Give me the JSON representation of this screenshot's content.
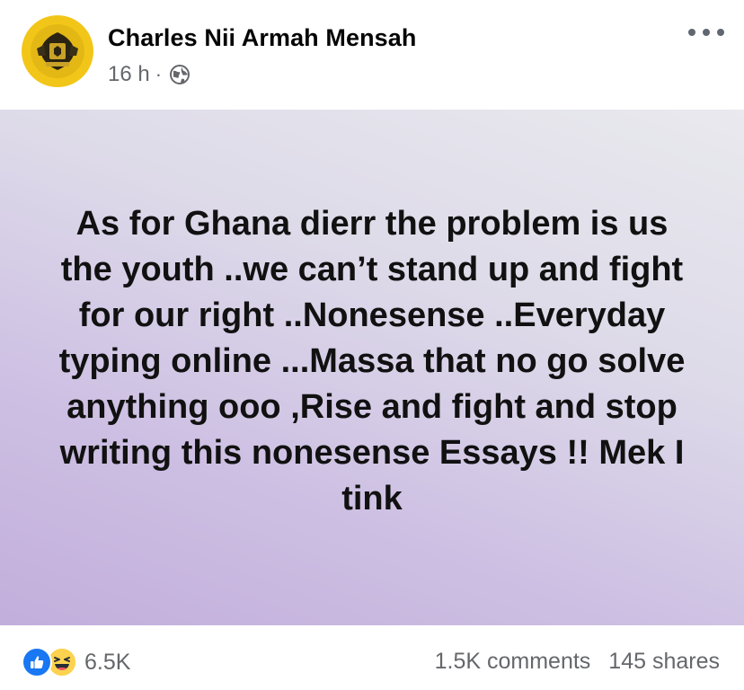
{
  "post": {
    "author": "Charles Nii Armah Mensah",
    "time": "16 h",
    "separator": "·",
    "privacy_icon": "globe-icon",
    "more_icon": "more-options-icon",
    "text": "As for Ghana dierr the problem is us the youth ..we can’t stand up and fight for our right ..Nonesense ..Everyday typing online ...Massa that no go solve anything ooo ,Rise and fight and stop writing this nonesense Essays !! Mek I tink",
    "background_colors": [
      "#e9e9ee",
      "#c2aedb"
    ]
  },
  "footer": {
    "reaction_icons": [
      "like-icon",
      "haha-icon"
    ],
    "reaction_count": "6.5K",
    "comments": "1.5K comments",
    "shares": "145 shares"
  },
  "colors": {
    "avatar_bg": "#f2c618",
    "like_blue": "#1877f2",
    "secondary_text": "#65676b"
  }
}
